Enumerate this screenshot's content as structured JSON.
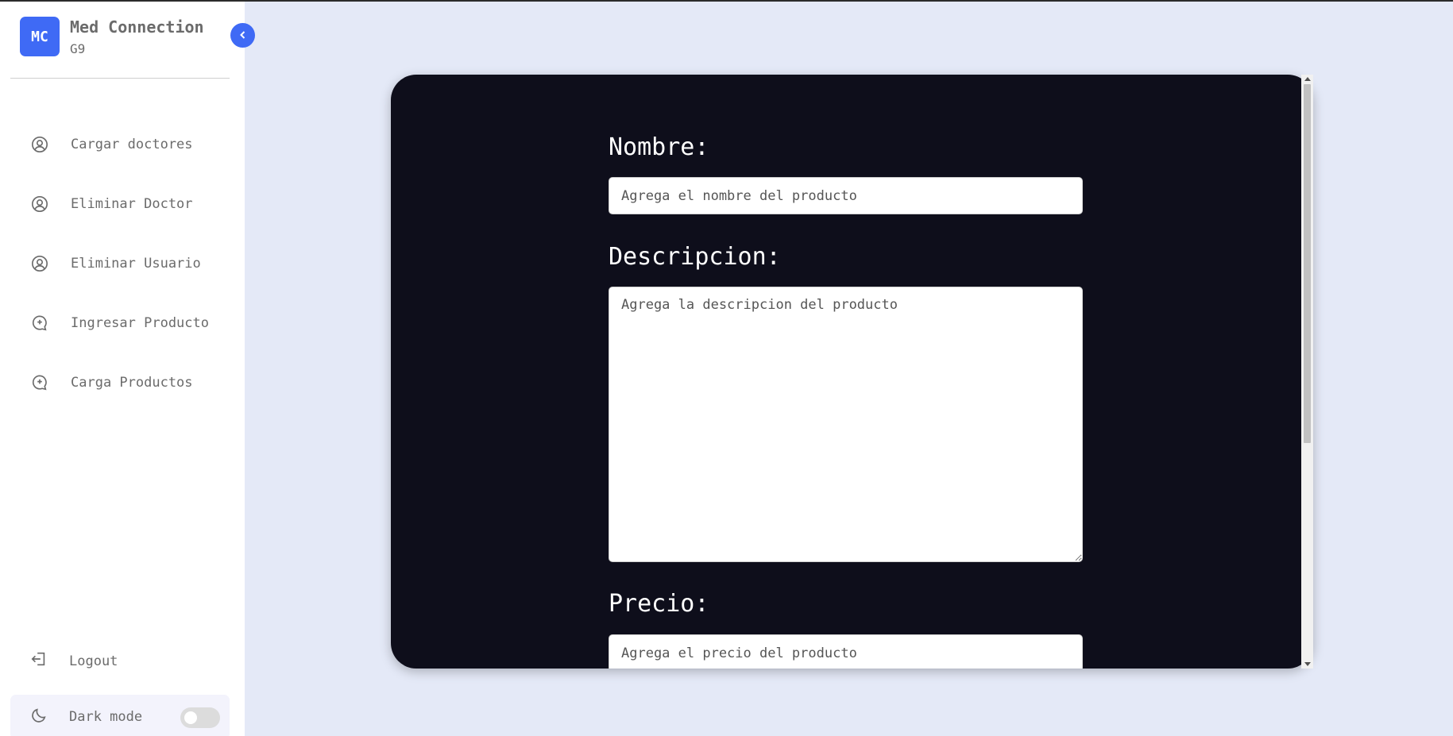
{
  "brand": {
    "logo": "MC",
    "name": "Med Connection",
    "subtitle": "G9"
  },
  "sidebar": {
    "collapse_icon": "chevron-left-icon",
    "items": [
      {
        "label": "Cargar doctores",
        "icon": "user-circle-icon"
      },
      {
        "label": "Eliminar Doctor",
        "icon": "user-circle-icon"
      },
      {
        "label": "Eliminar Usuario",
        "icon": "user-circle-icon"
      },
      {
        "label": "Ingresar Producto",
        "icon": "chat-plus-icon"
      },
      {
        "label": "Carga Productos",
        "icon": "chat-plus-icon"
      }
    ],
    "logout_label": "Logout",
    "dark_mode_label": "Dark mode",
    "dark_mode_on": false
  },
  "form": {
    "name_label": "Nombre:",
    "name_placeholder": "Agrega el nombre del producto",
    "description_label": "Descripcion:",
    "description_placeholder": "Agrega la descripcion del producto",
    "price_label": "Precio:",
    "price_placeholder": "Agrega el precio del producto"
  },
  "colors": {
    "accent": "#3f6af5",
    "page_background": "#e4e9f7",
    "panel_background": "#0e0e1b",
    "sidebar_text": "#6b6b6b"
  }
}
